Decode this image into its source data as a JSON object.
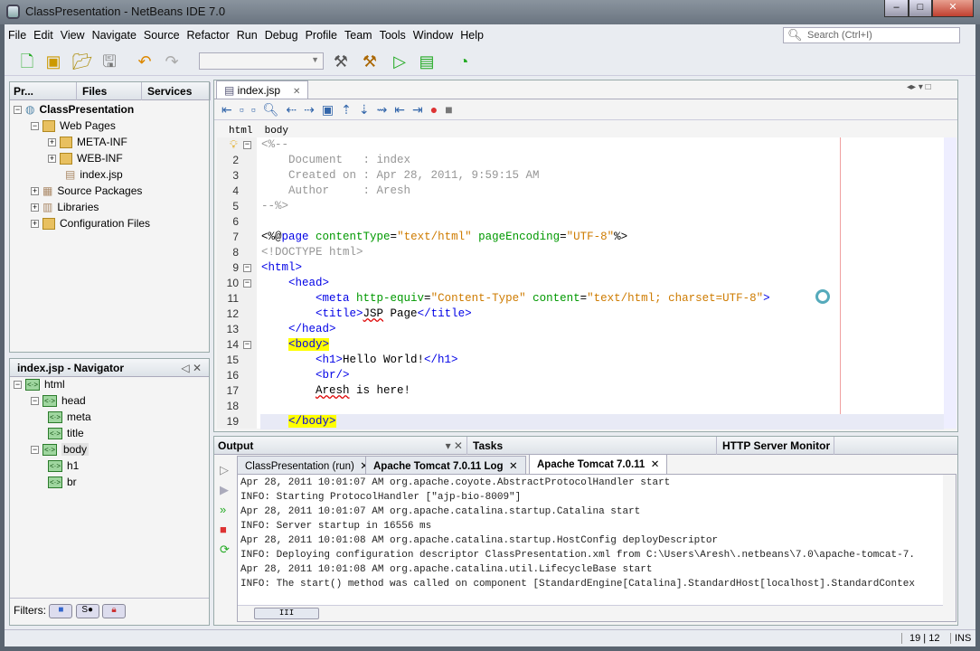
{
  "window": {
    "title": "ClassPresentation - NetBeans IDE 7.0"
  },
  "menu": [
    "File",
    "Edit",
    "View",
    "Navigate",
    "Source",
    "Refactor",
    "Run",
    "Debug",
    "Profile",
    "Team",
    "Tools",
    "Window",
    "Help"
  ],
  "search": {
    "placeholder": "Search (Ctrl+I)"
  },
  "left_tabs": [
    "Pr...",
    "Files",
    "Services"
  ],
  "project_tree": [
    {
      "label": "ClassPresentation",
      "depth": 0,
      "bold": true,
      "icon": "globe-icon"
    },
    {
      "label": "Web Pages",
      "depth": 1,
      "icon": "folder-icon"
    },
    {
      "label": "META-INF",
      "depth": 2,
      "icon": "folder-icon"
    },
    {
      "label": "WEB-INF",
      "depth": 2,
      "icon": "folder-icon"
    },
    {
      "label": "index.jsp",
      "depth": 3,
      "icon": "file-icon"
    },
    {
      "label": "Source Packages",
      "depth": 1,
      "icon": "package-icon"
    },
    {
      "label": "Libraries",
      "depth": 1,
      "icon": "library-icon"
    },
    {
      "label": "Configuration Files",
      "depth": 1,
      "icon": "folder-icon"
    }
  ],
  "navigator": {
    "title": "index.jsp - Navigator",
    "items": [
      {
        "label": "html",
        "depth": 0
      },
      {
        "label": "head",
        "depth": 1
      },
      {
        "label": "meta",
        "depth": 2
      },
      {
        "label": "title",
        "depth": 2
      },
      {
        "label": "body",
        "depth": 1
      },
      {
        "label": "h1",
        "depth": 2
      },
      {
        "label": "br",
        "depth": 2
      }
    ],
    "filters_label": "Filters:"
  },
  "editor": {
    "tab": "index.jsp",
    "breadcrumbs": [
      "html",
      "body"
    ],
    "lines": [
      [
        {
          "t": "<%--",
          "c": "comment"
        }
      ],
      [
        {
          "t": "    Document   : index",
          "c": "comment"
        }
      ],
      [
        {
          "t": "    Created on : Apr 28, 2011, 9:59:15 AM",
          "c": "comment"
        }
      ],
      [
        {
          "t": "    Author     : Aresh",
          "c": "comment"
        }
      ],
      [
        {
          "t": "--%>",
          "c": "comment"
        }
      ],
      [],
      [
        {
          "t": "<%@",
          "c": "dir"
        },
        {
          "t": "page",
          "c": "kw"
        },
        {
          "t": " contentType",
          "c": "attr"
        },
        {
          "t": "=",
          "c": "text"
        },
        {
          "t": "\"text/html\"",
          "c": "str"
        },
        {
          "t": " pageEncoding",
          "c": "attr"
        },
        {
          "t": "=",
          "c": "text"
        },
        {
          "t": "\"UTF-8\"",
          "c": "str"
        },
        {
          "t": "%>",
          "c": "dir"
        }
      ],
      [
        {
          "t": "<!DOCTYPE html>",
          "c": "doctype"
        }
      ],
      [
        {
          "t": "<html>",
          "c": "tag"
        }
      ],
      [
        {
          "t": "    ",
          "c": "text"
        },
        {
          "t": "<head>",
          "c": "tag"
        }
      ],
      [
        {
          "t": "        ",
          "c": "text"
        },
        {
          "t": "<meta",
          "c": "tag"
        },
        {
          "t": " http-equiv",
          "c": "attr"
        },
        {
          "t": "=",
          "c": "text"
        },
        {
          "t": "\"Content-Type\"",
          "c": "str"
        },
        {
          "t": " content",
          "c": "attr"
        },
        {
          "t": "=",
          "c": "text"
        },
        {
          "t": "\"text/html; charset=UTF-8\"",
          "c": "str"
        },
        {
          "t": ">",
          "c": "tag"
        }
      ],
      [
        {
          "t": "        ",
          "c": "text"
        },
        {
          "t": "<title>",
          "c": "tag"
        },
        {
          "t": "JSP",
          "c": "text sq"
        },
        {
          "t": " Page",
          "c": "text"
        },
        {
          "t": "</title>",
          "c": "tag"
        }
      ],
      [
        {
          "t": "    ",
          "c": "text"
        },
        {
          "t": "</head>",
          "c": "tag"
        }
      ],
      [
        {
          "t": "    ",
          "c": "text"
        },
        {
          "t": "<body>",
          "c": "tag hl"
        }
      ],
      [
        {
          "t": "        ",
          "c": "text"
        },
        {
          "t": "<h1>",
          "c": "tag"
        },
        {
          "t": "Hello World!",
          "c": "text"
        },
        {
          "t": "</h1>",
          "c": "tag"
        }
      ],
      [
        {
          "t": "        ",
          "c": "text"
        },
        {
          "t": "<br/>",
          "c": "tag"
        }
      ],
      [
        {
          "t": "        ",
          "c": "text"
        },
        {
          "t": "Aresh",
          "c": "text sq"
        },
        {
          "t": " is here!",
          "c": "text"
        }
      ],
      [],
      [
        {
          "t": "    ",
          "c": "text"
        },
        {
          "t": "</body>",
          "c": "tag hl"
        }
      ]
    ]
  },
  "output": {
    "title": "Output",
    "other_tabs": [
      "Tasks",
      "HTTP Server Monitor"
    ],
    "tabs": [
      "ClassPresentation (run)",
      "Apache Tomcat 7.0.11 Log",
      "Apache Tomcat 7.0.11"
    ],
    "lines": [
      "Apr 28, 2011 10:01:07 AM org.apache.coyote.AbstractProtocolHandler start",
      "INFO: Starting ProtocolHandler [\"ajp-bio-8009\"]",
      "Apr 28, 2011 10:01:07 AM org.apache.catalina.startup.Catalina start",
      "INFO: Server startup in 16556 ms",
      "Apr 28, 2011 10:01:08 AM org.apache.catalina.startup.HostConfig deployDescriptor",
      "INFO: Deploying configuration descriptor ClassPresentation.xml from C:\\Users\\Aresh\\.netbeans\\7.0\\apache-tomcat-7.",
      "Apr 28, 2011 10:01:08 AM org.apache.catalina.util.LifecycleBase start",
      "INFO: The start() method was called on component [StandardEngine[Catalina].StandardHost[localhost].StandardContex"
    ],
    "hscroll_thumb": "III"
  },
  "status": {
    "position": "19 | 12",
    "mode": "INS"
  }
}
